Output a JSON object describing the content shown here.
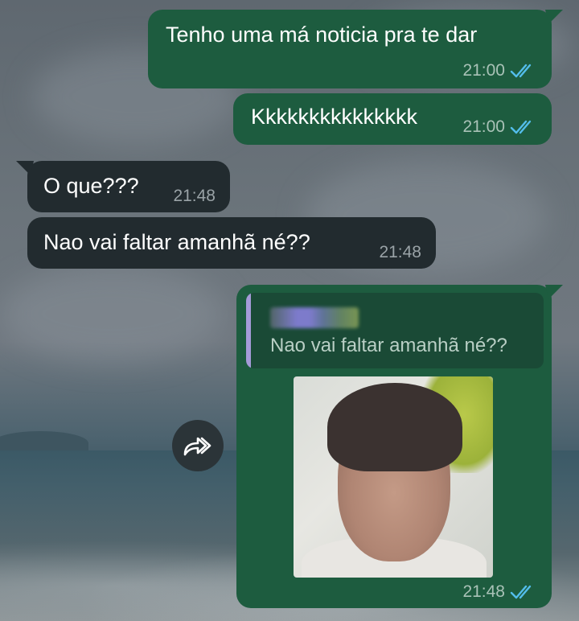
{
  "chat": {
    "messages": [
      {
        "direction": "outgoing",
        "text": "Tenho uma má noticia pra te dar",
        "time": "21:00",
        "status": "read"
      },
      {
        "direction": "outgoing",
        "text": "Kkkkkkkkkkkkkkk",
        "time": "21:00",
        "status": "read"
      },
      {
        "direction": "incoming",
        "text": "O que???",
        "time": "21:48"
      },
      {
        "direction": "incoming",
        "text": "Nao vai faltar amanhã né??",
        "time": "21:48"
      },
      {
        "direction": "outgoing",
        "type": "image-reply",
        "quoted_text": "Nao vai faltar amanhã né??",
        "time": "21:48",
        "status": "read"
      }
    ]
  },
  "icons": {
    "read_receipt": "double-check-icon",
    "forward": "forward-arrow-icon"
  },
  "colors": {
    "outgoing_bubble": "#1d5c3f",
    "incoming_bubble": "#222b2f",
    "read_tick": "#53bdeb",
    "quote_bar": "#a59bd8"
  }
}
